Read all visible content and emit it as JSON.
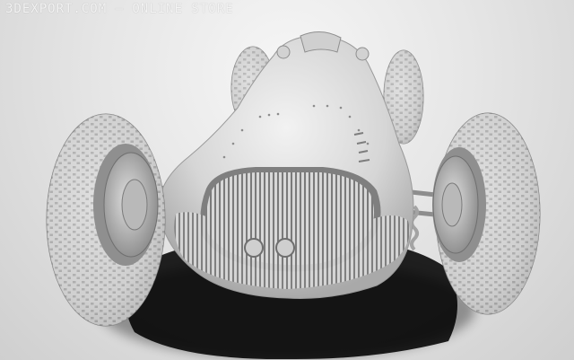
{
  "watermark": {
    "text": "3DEXPORT.COM – ONLINE STORE"
  },
  "scene": {
    "subject": "vintage-race-car-clay-render",
    "colors": {
      "background": "#e4e4e4",
      "body": "#d9d9d9",
      "shadow": "#0e0e0e",
      "tire": "#cfcfcf"
    }
  }
}
